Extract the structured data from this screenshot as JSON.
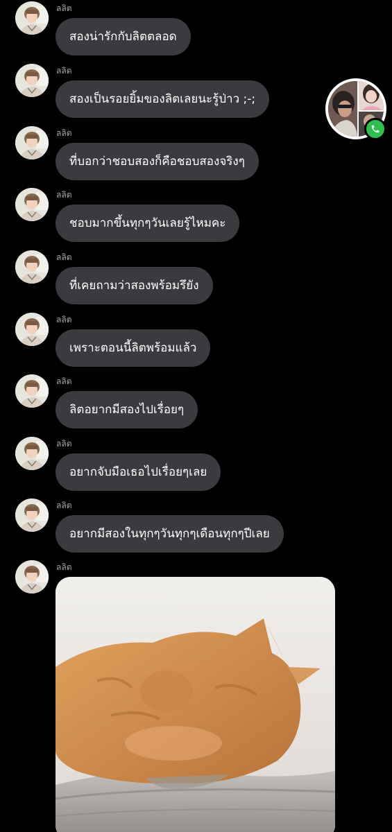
{
  "conversation": {
    "messages": [
      {
        "sender": "ลลิต",
        "text": "สองน่ารักกับลิตตลอด"
      },
      {
        "sender": "ลลิต",
        "text": "สองเป็นรอยยิ้มของลิตเลยนะรู้ป่าว ;-;"
      },
      {
        "sender": "ลลิต",
        "text": "ที่บอกว่าชอบสองก็คือชอบสองจริงๆ"
      },
      {
        "sender": "ลลิต",
        "text": "ชอบมากขึ้นทุกๆวันเลยรู้ไหมคะ"
      },
      {
        "sender": "ลลิต",
        "text": "ที่เคยถามว่าสองพร้อมรึยัง"
      },
      {
        "sender": "ลลิต",
        "text": "เพราะตอนนี้ลิตพร้อมแล้ว"
      },
      {
        "sender": "ลลิต",
        "text": "ลิตอยากมีสองไปเรื่อยๆ"
      },
      {
        "sender": "ลลิต",
        "text": "อยากจับมือเธอไปเรื่อยๆเลย"
      },
      {
        "sender": "ลลิต",
        "text": "อยากมีสองในทุกๆวันทุกๆเดือนทุกๆปีเลย"
      },
      {
        "sender": "ลลิต",
        "attachment": "photo"
      }
    ]
  },
  "call_bubble": {
    "icon": "phone-icon",
    "badge_color": "#2fbf4f"
  },
  "colors": {
    "background": "#000000",
    "bubble": "#3a3b3f",
    "text": "#ffffff",
    "sender": "#a9a9ad"
  }
}
